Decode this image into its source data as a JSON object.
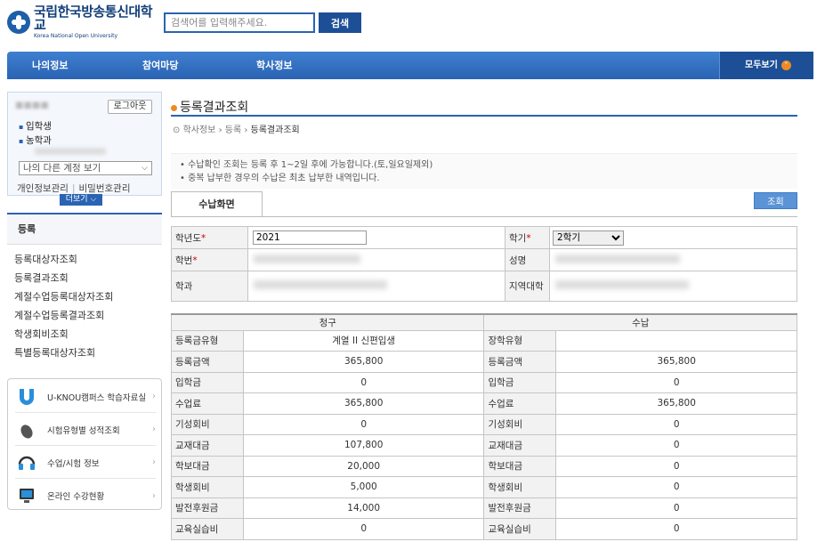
{
  "header": {
    "logo_text": "국립한국방송통신대학교",
    "logo_en": "Korea National Open University",
    "search_placeholder": "검색어를 입력해주세요.",
    "search_button": "검색"
  },
  "nav": {
    "items": [
      "나의정보",
      "참여마당",
      "학사정보"
    ],
    "view_all": "모두보기"
  },
  "user": {
    "logout": "로그아웃",
    "status": "입학생",
    "department": "농학과",
    "account_select": "나의 다른 계정 보기",
    "link_profile": "개인정보관리",
    "link_password": "비밀번호관리",
    "more": "더보기"
  },
  "side_menu": {
    "heading": "등록",
    "items": [
      "등록대상자조회",
      "등록결과조회",
      "계절수업등록대상자조회",
      "계절수업등록결과조회",
      "학생회비조회",
      "특별등록대상자조회"
    ]
  },
  "quick_links": [
    "U-KNOU캠퍼스 학습자료실",
    "시험유형별 성적조회",
    "수업/시험 정보",
    "온라인 수강현황"
  ],
  "page": {
    "title": "등록결과조회",
    "breadcrumb": [
      "학사정보",
      "등록",
      "등록결과조회"
    ],
    "notices": [
      "수납확인 조회는 등록 후 1~2일 후에 가능합니다.(토,일요일제외)",
      "중복 납부한 경우의 수납은 최초 납부한 내역입니다."
    ],
    "tab": "수납화면",
    "query_button": "조회"
  },
  "info": {
    "year_label": "학년도",
    "year_value": "2021",
    "semester_label": "학기",
    "semester_value": "2학기",
    "student_id_label": "학번",
    "name_label": "성명",
    "dept_label": "학과",
    "region_label": "지역대학"
  },
  "fees": {
    "header_billed": "청구",
    "header_paid": "수납",
    "rows": [
      {
        "label": "등록금유형",
        "billed": "계열 II 신편입생",
        "label2": "장학유형",
        "paid": ""
      },
      {
        "label": "등록금액",
        "billed": "365,800",
        "label2": "등록금액",
        "paid": "365,800"
      },
      {
        "label": "입학금",
        "billed": "0",
        "label2": "입학금",
        "paid": "0"
      },
      {
        "label": "수업료",
        "billed": "365,800",
        "label2": "수업료",
        "paid": "365,800"
      },
      {
        "label": "기성회비",
        "billed": "0",
        "label2": "기성회비",
        "paid": "0"
      },
      {
        "label": "교재대금",
        "billed": "107,800",
        "label2": "교재대금",
        "paid": "0"
      },
      {
        "label": "학보대금",
        "billed": "20,000",
        "label2": "학보대금",
        "paid": "0"
      },
      {
        "label": "학생회비",
        "billed": "5,000",
        "label2": "학생회비",
        "paid": "0"
      },
      {
        "label": "발전후원금",
        "billed": "14,000",
        "label2": "발전후원금",
        "paid": "0"
      },
      {
        "label": "교육실습비",
        "billed": "0",
        "label2": "교육실습비",
        "paid": "0"
      }
    ]
  }
}
